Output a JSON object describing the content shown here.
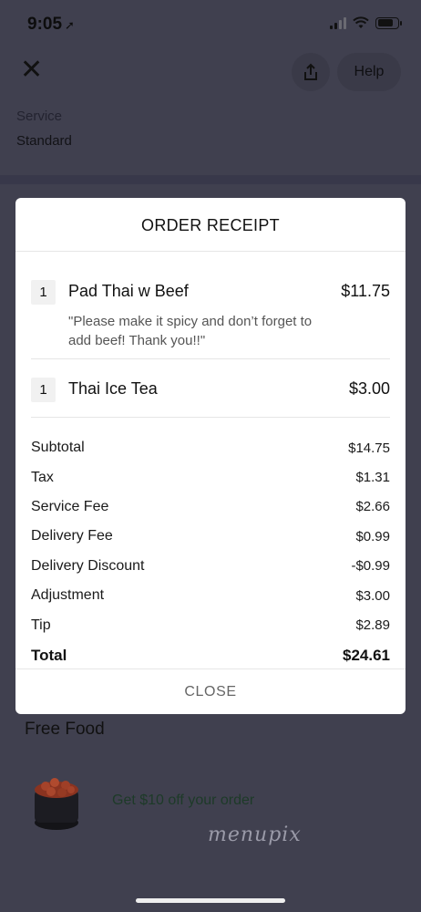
{
  "status_bar": {
    "time": "9:05",
    "location_glyph": "➚"
  },
  "header": {
    "help_label": "Help"
  },
  "service": {
    "label": "Service",
    "value": "Standard"
  },
  "receipt": {
    "title": "ORDER RECEIPT",
    "items": [
      {
        "qty": "1",
        "name": "Pad Thai w Beef",
        "price": "$11.75",
        "note": "\"Please make it spicy and don’t forget to add beef! Thank you!!\""
      },
      {
        "qty": "1",
        "name": "Thai Ice Tea",
        "price": "$3.00"
      }
    ],
    "summary": [
      {
        "label": "Subtotal",
        "value": "$14.75"
      },
      {
        "label": "Tax",
        "value": "$1.31"
      },
      {
        "label": "Service Fee",
        "value": "$2.66"
      },
      {
        "label": "Delivery Fee",
        "value": "$0.99"
      },
      {
        "label": "Delivery Discount",
        "value": "-$0.99"
      },
      {
        "label": "Adjustment",
        "value": "$3.00"
      },
      {
        "label": "Tip",
        "value": "$2.89"
      }
    ],
    "total": {
      "label": "Total",
      "value": "$24.61"
    },
    "close_label": "CLOSE"
  },
  "promo": {
    "section_title": "Free Food",
    "text": "Get $10 off your order"
  },
  "watermark": "menupix",
  "colors": {
    "overlay": "#40404f",
    "modal_bg": "#ffffff",
    "promo_text": "#1d3a28"
  }
}
